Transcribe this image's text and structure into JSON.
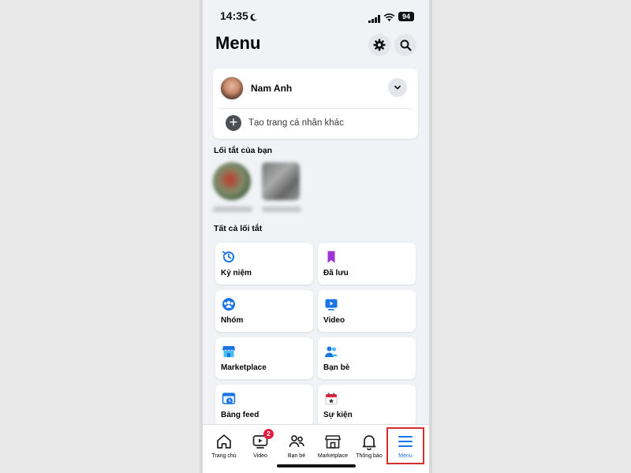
{
  "status_bar": {
    "time": "14:35",
    "battery": "94"
  },
  "header": {
    "title": "Menu",
    "settings_icon": "gear-icon",
    "search_icon": "search-icon"
  },
  "profile": {
    "name": "Nam Anh",
    "create_label": "Tạo trang cá nhân khác"
  },
  "sections": {
    "your_shortcuts": "Lối tắt của bạn",
    "all_shortcuts": "Tất cả lối tắt"
  },
  "tiles": [
    {
      "label": "Kỷ niệm",
      "icon": "memories-clock-icon"
    },
    {
      "label": "Đã lưu",
      "icon": "bookmark-icon"
    },
    {
      "label": "Nhóm",
      "icon": "groups-icon"
    },
    {
      "label": "Video",
      "icon": "video-icon"
    },
    {
      "label": "Marketplace",
      "icon": "marketplace-shop-icon"
    },
    {
      "label": "Bạn bè",
      "icon": "friends-icon"
    },
    {
      "label": "Bảng feed",
      "icon": "feeds-icon"
    },
    {
      "label": "Sự kiện",
      "icon": "calendar-star-icon"
    }
  ],
  "tabbar": {
    "items": [
      {
        "label": "Trang chủ",
        "icon": "home-icon"
      },
      {
        "label": "Video",
        "icon": "video-tv-icon",
        "badge": "2"
      },
      {
        "label": "Bạn bè",
        "icon": "friends-icon"
      },
      {
        "label": "Marketplace",
        "icon": "marketplace-shop-icon"
      },
      {
        "label": "Thông báo",
        "icon": "bell-icon"
      },
      {
        "label": "Menu",
        "icon": "hamburger-menu-icon"
      }
    ],
    "active": "Menu",
    "highlight_color": "#d32f2f"
  },
  "colors": {
    "accent": "#1877f2",
    "background": "#f0f2f5",
    "badge": "#e41e3f"
  }
}
